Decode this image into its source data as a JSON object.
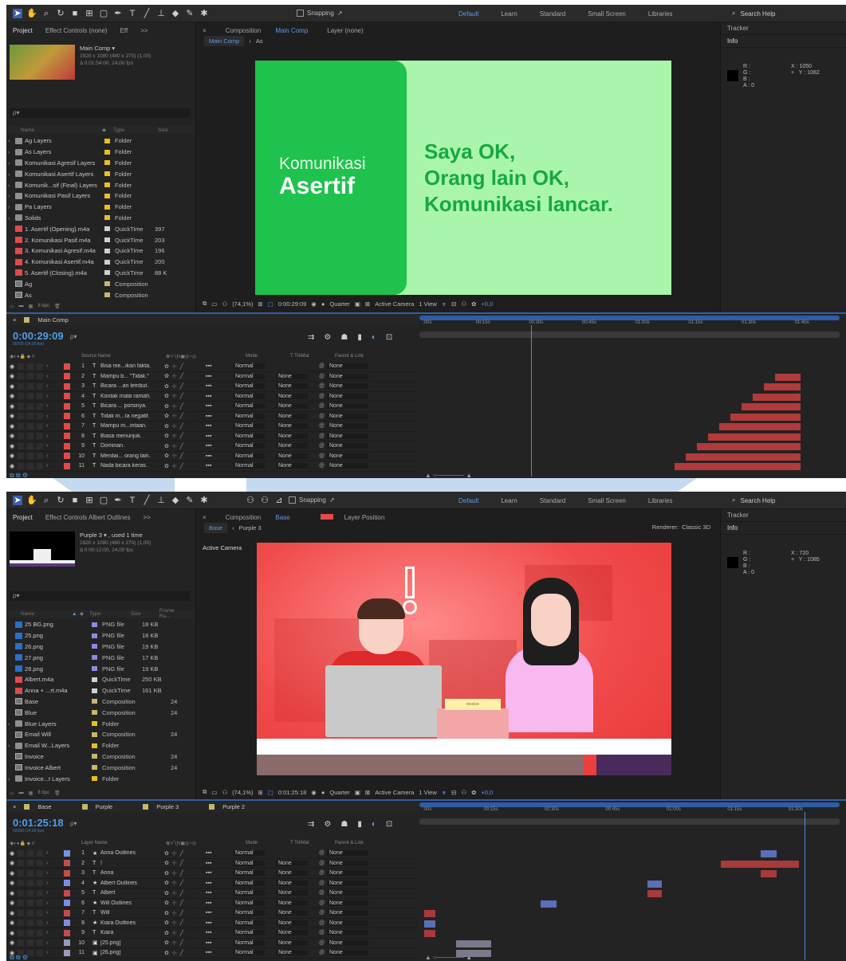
{
  "workspaces": {
    "default": "Default",
    "learn": "Learn",
    "standard": "Standard",
    "small": "Small Screen",
    "libraries": "Libraries",
    "search": "Search Help",
    "snapping": "Snapping"
  },
  "s1": {
    "project_tabs": [
      "Project",
      "Effect Controls (none)",
      "Eff",
      ">>"
    ],
    "comp_name": "Main Comp ▾",
    "comp_dims": "1920 x 1080  (480 x 270) (1,00)",
    "comp_dur": "Δ 0:01:54:00, 24,00 fps",
    "search": "ρ▾",
    "cols": [
      "Name",
      "Type",
      "Size"
    ],
    "items": [
      {
        "name": "Ag Layers",
        "type": "Folder",
        "size": "",
        "ic": "folder",
        "lb": "#e8c020"
      },
      {
        "name": "As Layers",
        "type": "Folder",
        "size": "",
        "ic": "folder",
        "lb": "#e8c020"
      },
      {
        "name": "Komunikasi Agresif Layers",
        "type": "Folder",
        "size": "",
        "ic": "folder",
        "lb": "#e8c020"
      },
      {
        "name": "Komunikasi Asertif Layers",
        "type": "Folder",
        "size": "",
        "ic": "folder",
        "lb": "#e8c020"
      },
      {
        "name": "Komunik...sif (Final) Layers",
        "type": "Folder",
        "size": "",
        "ic": "folder",
        "lb": "#e8c020"
      },
      {
        "name": "Komunikasi Pasif Layers",
        "type": "Folder",
        "size": "",
        "ic": "folder",
        "lb": "#e8c020"
      },
      {
        "name": "Pa Layers",
        "type": "Folder",
        "size": "",
        "ic": "folder",
        "lb": "#e8c020"
      },
      {
        "name": "Solids",
        "type": "Folder",
        "size": "",
        "ic": "folder",
        "lb": "#e8c020"
      },
      {
        "name": "1. Asertif (Opening).m4a",
        "type": "QuickTime",
        "size": "397",
        "ic": "audio",
        "lb": "#d0d0d0"
      },
      {
        "name": "2. Komunikasi Pasif.m4a",
        "type": "QuickTime",
        "size": "203",
        "ic": "audio",
        "lb": "#d0d0d0"
      },
      {
        "name": "3. Komunikasi Agresif.m4a",
        "type": "QuickTime",
        "size": "196",
        "ic": "audio",
        "lb": "#d0d0d0"
      },
      {
        "name": "4. Komunikasi Asertif.m4a",
        "type": "QuickTime",
        "size": "200",
        "ic": "audio",
        "lb": "#d0d0d0"
      },
      {
        "name": "5. Asertif (Closing).m4a",
        "type": "QuickTime",
        "size": "88 K",
        "ic": "audio",
        "lb": "#d0d0d0"
      },
      {
        "name": "Ag",
        "type": "Composition",
        "size": "",
        "ic": "comp",
        "lb": "#c8b66a"
      },
      {
        "name": "As",
        "type": "Composition",
        "size": "",
        "ic": "comp",
        "lb": "#c8b66a"
      }
    ],
    "bpc": "8 bpc",
    "viewer_tabs": {
      "comp": "Composition",
      "compname": "Main Comp",
      "layer": "Layer (none)",
      "sub1": "Main Comp",
      "sub2": "As"
    },
    "slide_title1": "Komunikasi",
    "slide_title2": "Asertif",
    "slide_l1": "Saya OK,",
    "slide_l2": "Orang lain OK,",
    "slide_l3": "Komunikasi lancar.",
    "vb": {
      "zoom": "(74,1%)",
      "time": "0:00:29:09",
      "res": "Quarter",
      "cam": "Active Camera",
      "view": "1 View",
      "exp": "+0,0"
    },
    "tracker": "Tracker",
    "info": "Info",
    "rgb": "R :\nG :\nB :\nA : 0",
    "xy": "X : 1050\n+   Y : 1082",
    "tl_tab": "Main Comp",
    "timecode": "0:00:29:09",
    "tc_sub": "00705 (24.00 fps)",
    "lhdr": [
      "Source Name",
      "Mode",
      "T TrkMat",
      "Parent & Link"
    ],
    "ruler": [
      ":00s",
      "00:15s",
      "00:30s",
      "00:45s",
      "01:00s",
      "01:15s",
      "01:30s",
      "01:45s"
    ],
    "layers": [
      {
        "n": "1",
        "t": "T",
        "name": "Bisa me...ikan fakta.",
        "mode": "Normal",
        "trk": "",
        "par": "None"
      },
      {
        "n": "2",
        "t": "T",
        "name": "Mampu b... \"Tidak.\"",
        "mode": "Normal",
        "trk": "None",
        "par": "None"
      },
      {
        "n": "3",
        "t": "T",
        "name": "Bicara ...an lembut.",
        "mode": "Normal",
        "trk": "None",
        "par": "None"
      },
      {
        "n": "4",
        "t": "T",
        "name": "Kontak mata ramah.",
        "mode": "Normal",
        "trk": "None",
        "par": "None"
      },
      {
        "n": "5",
        "t": "T",
        "name": "Bicara ... porsinya.",
        "mode": "Normal",
        "trk": "None",
        "par": "None"
      },
      {
        "n": "6",
        "t": "T",
        "name": "Tidak m...ra negatif.",
        "mode": "Normal",
        "trk": "None",
        "par": "None"
      },
      {
        "n": "7",
        "t": "T",
        "name": "Mampu m...intaan.",
        "mode": "Normal",
        "trk": "None",
        "par": "None"
      },
      {
        "n": "8",
        "t": "T",
        "name": "Biasa menunjuk.",
        "mode": "Normal",
        "trk": "None",
        "par": "None"
      },
      {
        "n": "9",
        "t": "T",
        "name": "Dominan.",
        "mode": "Normal",
        "trk": "None",
        "par": "None"
      },
      {
        "n": "10",
        "t": "T",
        "name": "Menilai... orang lain.",
        "mode": "Normal",
        "trk": "None",
        "par": "None"
      },
      {
        "n": "11",
        "t": "T",
        "name": "Nada bicara keras.",
        "mode": "Normal",
        "trk": "None",
        "par": "None"
      }
    ]
  },
  "s2": {
    "project_tabs": [
      "Project",
      "Effect Controls Albert Outlines",
      ">>"
    ],
    "comp_name": "Purple 3 ▾ , used 1 time",
    "comp_dims": "1920 x 1080  (480 x 270) (1,00)",
    "comp_dur": "Δ 0:00:12:00, 24,00 fps",
    "search": "ρ▾",
    "cols": [
      "Name",
      "Type",
      "Size",
      "Frame Ra..."
    ],
    "items": [
      {
        "name": "25 BG.png",
        "type": "PNG file",
        "size": "18 KB",
        "fr": "",
        "ic": "png",
        "lb": "#8a8ae0"
      },
      {
        "name": "25.png",
        "type": "PNG file",
        "size": "18 KB",
        "fr": "",
        "ic": "png",
        "lb": "#8a8ae0"
      },
      {
        "name": "26.png",
        "type": "PNG file",
        "size": "19 KB",
        "fr": "",
        "ic": "png",
        "lb": "#8a8ae0"
      },
      {
        "name": "27.png",
        "type": "PNG file",
        "size": "17 KB",
        "fr": "",
        "ic": "png",
        "lb": "#8a8ae0"
      },
      {
        "name": "28.png",
        "type": "PNG file",
        "size": "19 KB",
        "fr": "",
        "ic": "png",
        "lb": "#8a8ae0"
      },
      {
        "name": "Albert.m4a",
        "type": "QuickTime",
        "size": "250 KB",
        "fr": "",
        "ic": "audio",
        "lb": "#d0d0d0"
      },
      {
        "name": "Anna + ...rt.m4a",
        "type": "QuickTime",
        "size": "161 KB",
        "fr": "",
        "ic": "audio",
        "lb": "#d0d0d0"
      },
      {
        "name": "Base",
        "type": "Composition",
        "size": "",
        "fr": "24",
        "ic": "comp",
        "lb": "#c8b66a"
      },
      {
        "name": "Blue",
        "type": "Composition",
        "size": "",
        "fr": "24",
        "ic": "comp",
        "lb": "#c8b66a"
      },
      {
        "name": "Blue Layers",
        "type": "Folder",
        "size": "",
        "fr": "",
        "ic": "folder",
        "lb": "#e8c020"
      },
      {
        "name": "Email Will",
        "type": "Composition",
        "size": "",
        "fr": "24",
        "ic": "comp",
        "lb": "#c8b66a"
      },
      {
        "name": "Email W...Layers",
        "type": "Folder",
        "size": "",
        "fr": "",
        "ic": "folder",
        "lb": "#e8c020"
      },
      {
        "name": "Invoice",
        "type": "Composition",
        "size": "",
        "fr": "24",
        "ic": "comp",
        "lb": "#c8b66a"
      },
      {
        "name": "Invoice Albert",
        "type": "Composition",
        "size": "",
        "fr": "24",
        "ic": "comp",
        "lb": "#c8b66a"
      },
      {
        "name": "Invoice...t Layers",
        "type": "Folder",
        "size": "",
        "fr": "",
        "ic": "folder",
        "lb": "#e8c020"
      }
    ],
    "bpc": "8 bpc",
    "viewer_tabs": {
      "comp": "Composition",
      "compname": "Base",
      "layer": "Layer Position",
      "sub1": "Base",
      "sub2": "Purple 3",
      "renderer": "Renderer:",
      "rend_val": "Classic 3D",
      "active": "Active Camera"
    },
    "note": "invoice",
    "vb": {
      "zoom": "(74,1%)",
      "time": "0:01:25:18",
      "res": "Quarter",
      "cam": "Active Camera",
      "view": "1 View",
      "exp": "+0,0"
    },
    "tracker": "Tracker",
    "info": "Info",
    "rgb": "R :\nG :\nB :\nA : 0",
    "xy": "X : 720\n+   Y : 1085",
    "tl_tabs": [
      "Base",
      "Purple",
      "Purple 3",
      "Purple 2"
    ],
    "timecode": "0:01:25:18",
    "tc_sub": "02058 (24.00 fps)",
    "lhdr": [
      "Layer Name",
      "Mode",
      "T TrkMat",
      "Parent & Link"
    ],
    "ruler": [
      ":00s",
      "00:15s",
      "00:30s",
      "00:45s",
      "01:00s",
      "01:15s",
      "01:30s"
    ],
    "layers": [
      {
        "n": "1",
        "t": "★",
        "name": "Anna Outlines",
        "mode": "Normal",
        "trk": "",
        "par": "None",
        "c": "#7a8fe0"
      },
      {
        "n": "2",
        "t": "T",
        "name": "!",
        "mode": "Normal",
        "trk": "None",
        "par": "None",
        "c": "#c94a4a"
      },
      {
        "n": "3",
        "t": "T",
        "name": "Anna",
        "mode": "Normal",
        "trk": "None",
        "par": "None",
        "c": "#c94a4a"
      },
      {
        "n": "4",
        "t": "★",
        "name": "Albert Outlines",
        "mode": "Normal",
        "trk": "None",
        "par": "None",
        "c": "#7a8fe0"
      },
      {
        "n": "5",
        "t": "T",
        "name": "Albert",
        "mode": "Normal",
        "trk": "None",
        "par": "None",
        "c": "#c94a4a"
      },
      {
        "n": "6",
        "t": "★",
        "name": "Will Outlines",
        "mode": "Normal",
        "trk": "None",
        "par": "None",
        "c": "#7a8fe0"
      },
      {
        "n": "7",
        "t": "T",
        "name": "Will",
        "mode": "Normal",
        "trk": "None",
        "par": "None",
        "c": "#c94a4a"
      },
      {
        "n": "8",
        "t": "★",
        "name": "Kiara Outlines",
        "mode": "Normal",
        "trk": "None",
        "par": "None",
        "c": "#7a8fe0"
      },
      {
        "n": "9",
        "t": "T",
        "name": "Kiara",
        "mode": "Normal",
        "trk": "None",
        "par": "None",
        "c": "#c94a4a"
      },
      {
        "n": "10",
        "t": "▣",
        "name": "[25.png]",
        "mode": "Normal",
        "trk": "None",
        "par": "None",
        "c": "#9a9ab8"
      },
      {
        "n": "11",
        "t": "▣",
        "name": "[26.png]",
        "mode": "Normal",
        "trk": "None",
        "par": "None",
        "c": "#9a9ab8"
      }
    ]
  }
}
